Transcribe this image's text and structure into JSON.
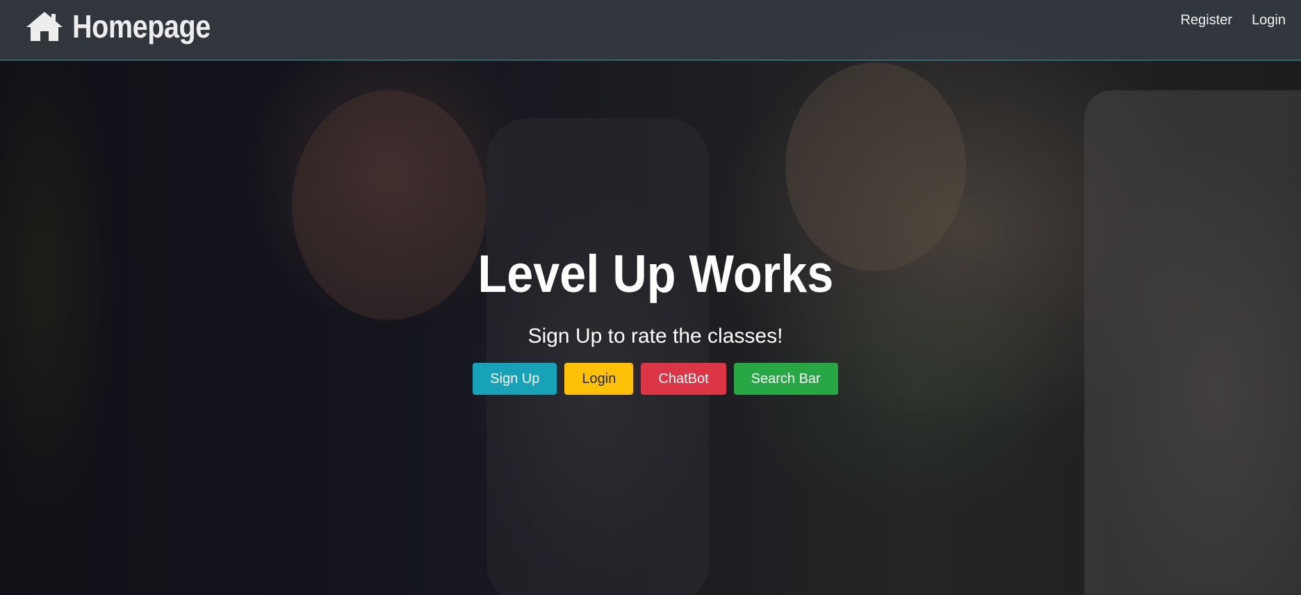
{
  "navbar": {
    "brand_label": "Homepage",
    "brand_icon": "home-icon",
    "links": [
      {
        "label": "Register"
      },
      {
        "label": "Login"
      }
    ]
  },
  "hero": {
    "title": "Level Up Works",
    "subtitle": "Sign Up to rate the classes!",
    "buttons": [
      {
        "label": "Sign Up",
        "color": "#17a2b8"
      },
      {
        "label": "Login",
        "color": "#ffc107"
      },
      {
        "label": "ChatBot",
        "color": "#dc3545"
      },
      {
        "label": "Search Bar",
        "color": "#28a745"
      }
    ]
  },
  "colors": {
    "navbar_bg": "#343a40",
    "text_light": "#ffffff"
  }
}
